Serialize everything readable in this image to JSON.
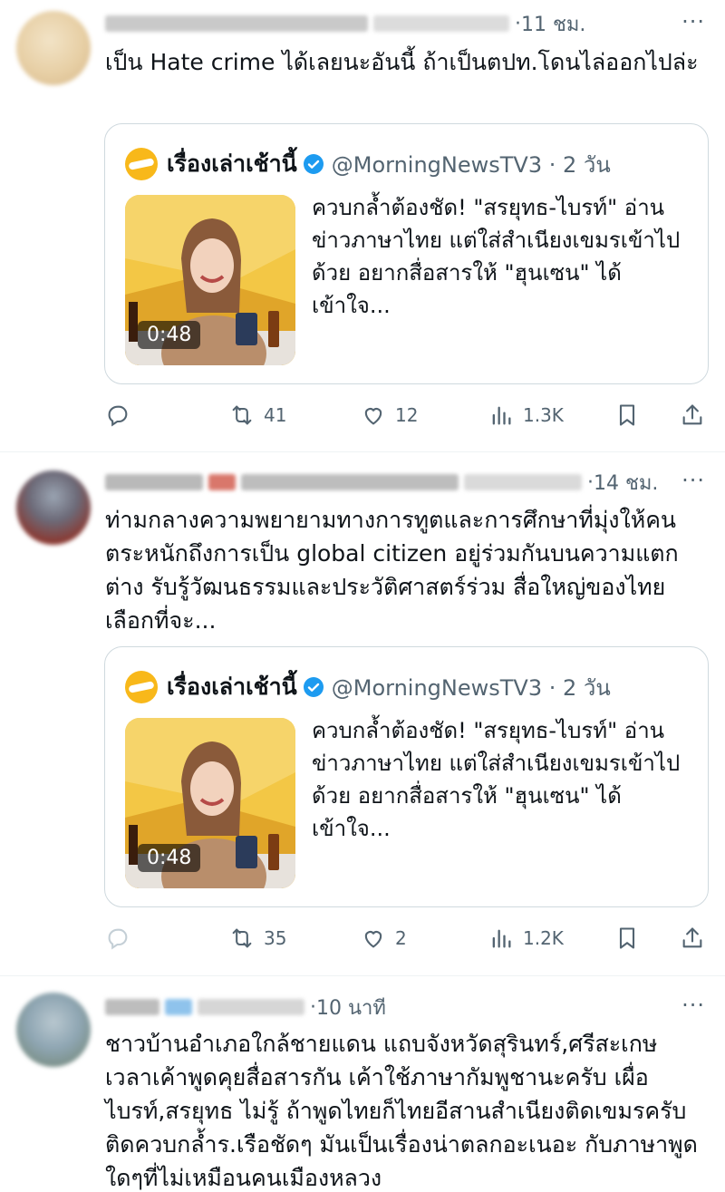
{
  "tweets": [
    {
      "time": "11 ชม.",
      "text": "เป็น Hate crime ได้เลยนะอันนี้ ถ้าเป็นตปท.โดนไล่ออกไปล่ะ",
      "quote": {
        "name": "เรื่องเล่าเช้านี้",
        "handle": "@MorningNewsTV3 · 2 วัน",
        "text": "ควบกล้ำต้องชัด! \"สรยุทธ-ไบรท์\" อ่านข่าวภาษาไทย แต่ใส่สำเนียงเขมรเข้าไปด้วย อยากสื่อสารให้ \"ฮุนเซน\" ได้เข้าใจ...",
        "duration": "0:48"
      },
      "actions": {
        "retweets": "41",
        "likes": "12",
        "views": "1.3K"
      }
    },
    {
      "time": "14 ชม.",
      "text": "ท่ามกลางความพยายามทางการทูตและการศึกษาที่มุ่งให้คนตระหนักถึงการเป็น global citizen อยู่ร่วมกันบนความแตกต่าง รับรู้วัฒนธรรมและประวัติศาสตร์ร่วม สื่อใหญ่ของไทยเลือกที่จะ...",
      "quote": {
        "name": "เรื่องเล่าเช้านี้",
        "handle": "@MorningNewsTV3 · 2 วัน",
        "text": "ควบกล้ำต้องชัด! \"สรยุทธ-ไบรท์\" อ่านข่าวภาษาไทย แต่ใส่สำเนียงเขมรเข้าไปด้วย อยากสื่อสารให้ \"ฮุนเซน\" ได้เข้าใจ...",
        "duration": "0:48"
      },
      "actions": {
        "retweets": "35",
        "likes": "2",
        "views": "1.2K"
      }
    },
    {
      "time": "10 นาที",
      "text": "ชาวบ้านอำเภอใกล้ชายแดน แถบจังหวัดสุรินทร์,ศรีสะเกษ เวลาเค้าพูดคุยสื่อสารกัน เค้าใช้ภาษากัมพูชานะครับ เผื่อไบรท์,สรยุทธ ไม่รู้ ถ้าพูดไทยก็ไทยอีสานสำเนียงติดเขมรครับ ติดควบกล้ำร.เรือชัดๆ มันเป็นเรื่องน่าตลกอะเนอะ กับภาษาพูด ใดๆที่ไม่เหมือนคนเมืองหลวง"
    }
  ],
  "ui": {
    "more": "···",
    "icons": [
      "reply-icon",
      "retweet-icon",
      "like-icon",
      "views-icon",
      "bookmark-icon",
      "share-icon",
      "verified-icon",
      "more-icon"
    ],
    "colors": {
      "text": "#0f1419",
      "secondary": "#536471",
      "border": "#cfd9de",
      "verified": "#1d9bf0",
      "logo": "#f8b81a"
    }
  }
}
